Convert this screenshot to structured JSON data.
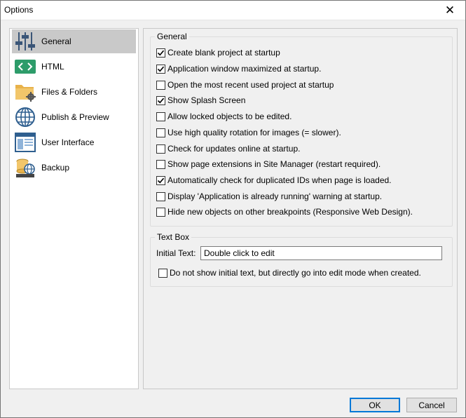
{
  "window": {
    "title": "Options"
  },
  "sidebar": {
    "items": [
      {
        "label": "General",
        "icon": "sliders-icon",
        "selected": true
      },
      {
        "label": "HTML",
        "icon": "code-icon",
        "selected": false
      },
      {
        "label": "Files & Folders",
        "icon": "folder-gear-icon",
        "selected": false
      },
      {
        "label": "Publish & Preview",
        "icon": "globe-icon",
        "selected": false
      },
      {
        "label": "User Interface",
        "icon": "window-icon",
        "selected": false
      },
      {
        "label": "Backup",
        "icon": "database-globe-icon",
        "selected": false
      }
    ]
  },
  "general": {
    "title": "General",
    "options": [
      {
        "label": "Create blank project at startup",
        "checked": true
      },
      {
        "label": "Application window maximized at startup.",
        "checked": true
      },
      {
        "label": "Open the most recent used project at startup",
        "checked": false
      },
      {
        "label": "Show Splash Screen",
        "checked": true
      },
      {
        "label": "Allow locked objects to be edited.",
        "checked": false
      },
      {
        "label": "Use high quality rotation for images (= slower).",
        "checked": false
      },
      {
        "label": "Check for updates online at startup.",
        "checked": false
      },
      {
        "label": "Show page extensions in Site Manager (restart required).",
        "checked": false
      },
      {
        "label": "Automatically check for duplicated IDs when page is loaded.",
        "checked": true
      },
      {
        "label": "Display 'Application is already running' warning at startup.",
        "checked": false
      },
      {
        "label": "Hide new objects on other breakpoints (Responsive Web Design).",
        "checked": false
      }
    ]
  },
  "textbox": {
    "title": "Text Box",
    "initial_text_label": "Initial Text:",
    "initial_text_value": "Double click to edit",
    "option": {
      "label": "Do not show initial text, but directly go into edit mode when created.",
      "checked": false
    }
  },
  "buttons": {
    "ok": "OK",
    "cancel": "Cancel"
  },
  "colors": {
    "accent": "#0078d7",
    "selected_bg": "#c9c9c9",
    "html_icon": "#2d9c6a",
    "folder": "#e8b24a"
  }
}
